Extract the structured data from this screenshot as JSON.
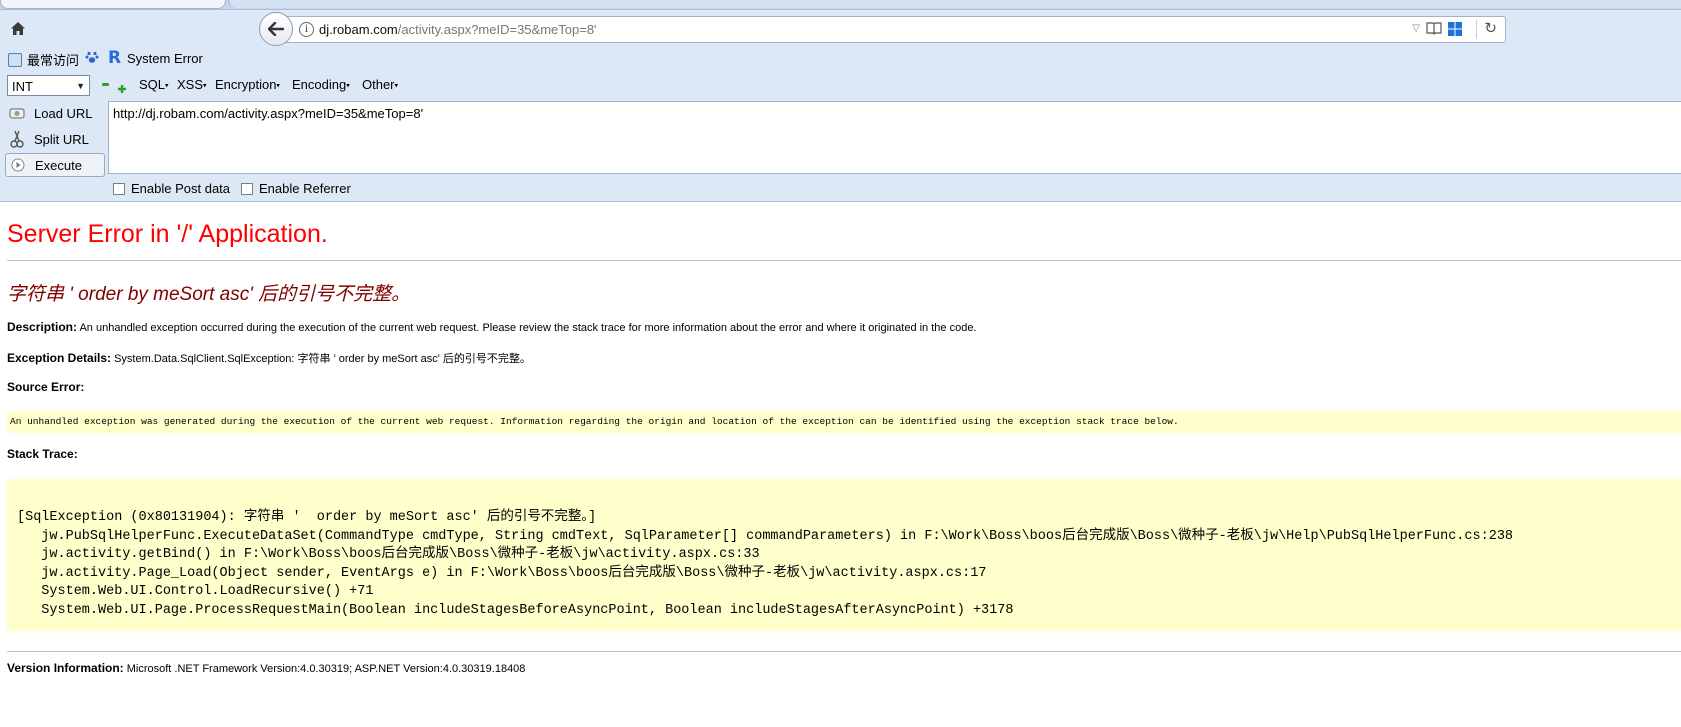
{
  "browser": {
    "url_host": "dj.robam.com",
    "url_path": "/activity.aspx?meID=35&meTop=8'",
    "bookmarks": [
      {
        "label": "最常访问",
        "icon": "bookmark-folder-icon"
      },
      {
        "label": "",
        "icon": "baidu-paw-icon"
      },
      {
        "label": "System Error",
        "icon": "r-logo-icon"
      }
    ]
  },
  "hackbar": {
    "select_value": "INT",
    "menus": [
      "SQL",
      "XSS",
      "Encryption",
      "Encoding",
      "Other"
    ],
    "side_buttons": [
      {
        "label": "Load URL",
        "icon": "load-url-icon"
      },
      {
        "label": "Split URL",
        "icon": "split-url-icon"
      },
      {
        "label": "Execute",
        "icon": "execute-icon"
      }
    ],
    "url_value": "http://dj.robam.com/activity.aspx?meID=35&meTop=8'",
    "options": [
      "Enable Post data",
      "Enable Referrer"
    ]
  },
  "page": {
    "title": "Server Error in '/' Application.",
    "message": "字符串 '  order by meSort asc' 后的引号不完整。",
    "description_label": "Description:",
    "description_text": "An unhandled exception occurred during the execution of the current web request. Please review the stack trace for more information about the error and where it originated in the code.",
    "exception_label": "Exception Details:",
    "exception_text": "System.Data.SqlClient.SqlException: 字符串 '  order by meSort asc' 后的引号不完整。",
    "source_label": "Source Error:",
    "source_text": "An unhandled exception was generated during the execution of the current web request. Information regarding the origin and location of the exception can be identified using the exception stack trace below.",
    "stack_label": "Stack Trace:",
    "stack_lines": [
      "[SqlException (0x80131904): 字符串 '  order by meSort asc' 后的引号不完整。]",
      "   jw.PubSqlHelperFunc.ExecuteDataSet(CommandType cmdType, String cmdText, SqlParameter[] commandParameters) in F:\\Work\\Boss\\boos后台完成版\\Boss\\微种子-老板\\jw\\Help\\PubSqlHelperFunc.cs:238",
      "   jw.activity.getBind() in F:\\Work\\Boss\\boos后台完成版\\Boss\\微种子-老板\\jw\\activity.aspx.cs:33",
      "   jw.activity.Page_Load(Object sender, EventArgs e) in F:\\Work\\Boss\\boos后台完成版\\Boss\\微种子-老板\\jw\\activity.aspx.cs:17",
      "   System.Web.UI.Control.LoadRecursive() +71",
      "   System.Web.UI.Page.ProcessRequestMain(Boolean includeStagesBeforeAsyncPoint, Boolean includeStagesAfterAsyncPoint) +3178"
    ],
    "version_label": "Version Information:",
    "version_text": "Microsoft .NET Framework Version:4.0.30319; ASP.NET Version:4.0.30319.18408"
  },
  "colors": {
    "chrome_bg": "#dde8f6",
    "error_title": "#ff0000",
    "error_message": "#800000",
    "code_bg": "#ffffcc"
  }
}
